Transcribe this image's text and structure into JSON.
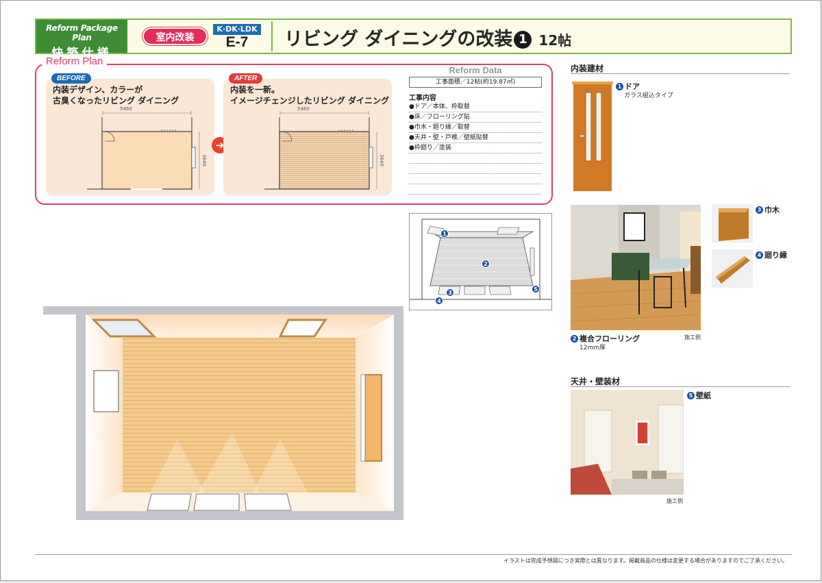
{
  "header": {
    "brand_en": "Reform Package Plan",
    "brand_jp": "快築仕様",
    "category_pill": "室内改装",
    "room_type": "K·DK·LDK",
    "plan_code": "E-7",
    "title": "リビング ダイニングの改装",
    "title_number": "1",
    "title_size": "12帖"
  },
  "reform_plan": {
    "label": "Reform Plan",
    "before": {
      "tag": "BEFORE",
      "line1": "内装デザイン、カラーが",
      "line2": "古臭くなったリビング ダイニング",
      "width_dim": "5460",
      "depth_dim": "3640"
    },
    "after": {
      "tag": "AFTER",
      "line1": "内装を一新。",
      "line2": "イメージチェンジしたリビング ダイニング",
      "width_dim": "5460",
      "depth_dim": "3640"
    },
    "arrow": "➔"
  },
  "reform_data": {
    "heading": "Reform Data",
    "area": "工事面積／12帖(約19.87㎡)",
    "work_heading": "工事内容",
    "items": [
      "●ドア／本体、枠取替",
      "●床／フローリング貼",
      "●巾木・廻り縁／取替",
      "●天井・壁・戸襖／壁紙貼替",
      "●枠廻り／塗装",
      "",
      "",
      "",
      ""
    ]
  },
  "key_badges": [
    "1",
    "2",
    "3",
    "4",
    "5"
  ],
  "materials": {
    "interior_heading": "内装建材",
    "door": {
      "num": "1",
      "name": "ドア",
      "sub": "ガラス組込タイプ"
    },
    "baseboard": {
      "num": "3",
      "name": "巾木"
    },
    "molding": {
      "num": "4",
      "name": "廻り縁"
    },
    "flooring": {
      "num": "2",
      "name": "複合フローリング",
      "sub": "12mm厚",
      "note": "施工例"
    },
    "ceiling_heading": "天井・壁装材",
    "wallpaper": {
      "num": "5",
      "name": "壁紙",
      "note": "施工例"
    }
  },
  "footer": "イラストは完成予想図につき実際とは異なります。掲載商品の仕様は変更する場合がありますのでご了承ください。",
  "colors": {
    "brand_green": "#3d8d35",
    "accent_pink": "#e22c5a",
    "badge_blue": "#1b4f9c",
    "floor_wood": "#f2c98a"
  }
}
